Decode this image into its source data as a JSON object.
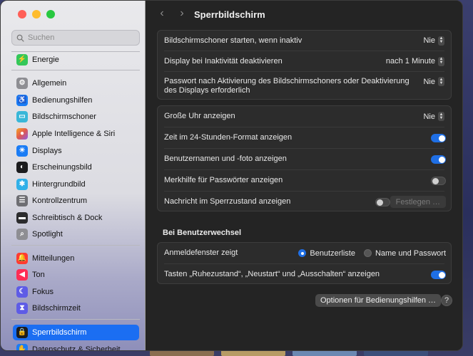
{
  "window": {
    "title": "Sperrbildschirm"
  },
  "search": {
    "placeholder": "Suchen"
  },
  "sidebar": {
    "items": [
      {
        "label": "Energie",
        "icon": "battery-icon",
        "color": "#34c759"
      },
      {
        "label": "Allgemein",
        "icon": "gear-icon",
        "color": "#8e8e93"
      },
      {
        "label": "Bedienungshilfen",
        "icon": "accessibility-icon",
        "color": "#1a7cf5"
      },
      {
        "label": "Bildschirmschoner",
        "icon": "screensaver-icon",
        "color": "#39b7d8"
      },
      {
        "label": "Apple Intelligence & Siri",
        "icon": "siri-icon",
        "color": "#e0584f"
      },
      {
        "label": "Displays",
        "icon": "sun-icon",
        "color": "#1a7cf5"
      },
      {
        "label": "Erscheinungsbild",
        "icon": "appearance-icon",
        "color": "#1c1c1e"
      },
      {
        "label": "Hintergrundbild",
        "icon": "wallpaper-icon",
        "color": "#30b0e8"
      },
      {
        "label": "Kontrollzentrum",
        "icon": "control-center-icon",
        "color": "#6e6e73"
      },
      {
        "label": "Schreibtisch & Dock",
        "icon": "dock-icon",
        "color": "#2c2c2e"
      },
      {
        "label": "Spotlight",
        "icon": "spotlight-icon",
        "color": "#8e8e93"
      },
      {
        "label": "Mitteilungen",
        "icon": "bell-icon",
        "color": "#ff3b30"
      },
      {
        "label": "Ton",
        "icon": "speaker-icon",
        "color": "#ff2d55"
      },
      {
        "label": "Fokus",
        "icon": "moon-icon",
        "color": "#5e5ce6"
      },
      {
        "label": "Bildschirmzeit",
        "icon": "hourglass-icon",
        "color": "#5e5ce6"
      },
      {
        "label": "Sperrbildschirm",
        "icon": "lock-icon",
        "color": "#1c1c1e"
      },
      {
        "label": "Datenschutz & Sicherheit",
        "icon": "hand-icon",
        "color": "#1a7cf5"
      }
    ]
  },
  "group1": {
    "rows": [
      {
        "label": "Bildschirmschoner starten, wenn inaktiv",
        "value": "Nie"
      },
      {
        "label": "Display bei Inaktivität deaktivieren",
        "value": "nach 1 Minute"
      },
      {
        "label": "Passwort nach Aktivierung des Bildschirmschoners oder Deaktivierung des Displays erforderlich",
        "value": "Nie"
      }
    ]
  },
  "group2": {
    "rows": [
      {
        "label": "Große Uhr anzeigen",
        "value": "Nie"
      },
      {
        "label": "Zeit im 24-Stunden-Format anzeigen",
        "on": true
      },
      {
        "label": "Benutzernamen und -foto anzeigen",
        "on": true
      },
      {
        "label": "Merkhilfe für Passwörter anzeigen",
        "on": false
      },
      {
        "label": "Nachricht im Sperrzustand anzeigen",
        "on": false,
        "button": "Festlegen …"
      }
    ]
  },
  "user_switch": {
    "heading": "Bei Benutzerwechsel",
    "login_label": "Anmeldefenster zeigt",
    "options": [
      "Benutzerliste",
      "Name und Passwort"
    ],
    "selected": "Benutzerliste",
    "keys_label": "Tasten „Ruhezustand“, „Neustart“ und „Ausschalten“ anzeigen",
    "keys_on": true
  },
  "footer": {
    "accessibility_button": "Optionen für Bedienungshilfen …",
    "help": "?"
  },
  "accent_color": "#1f6fe5"
}
